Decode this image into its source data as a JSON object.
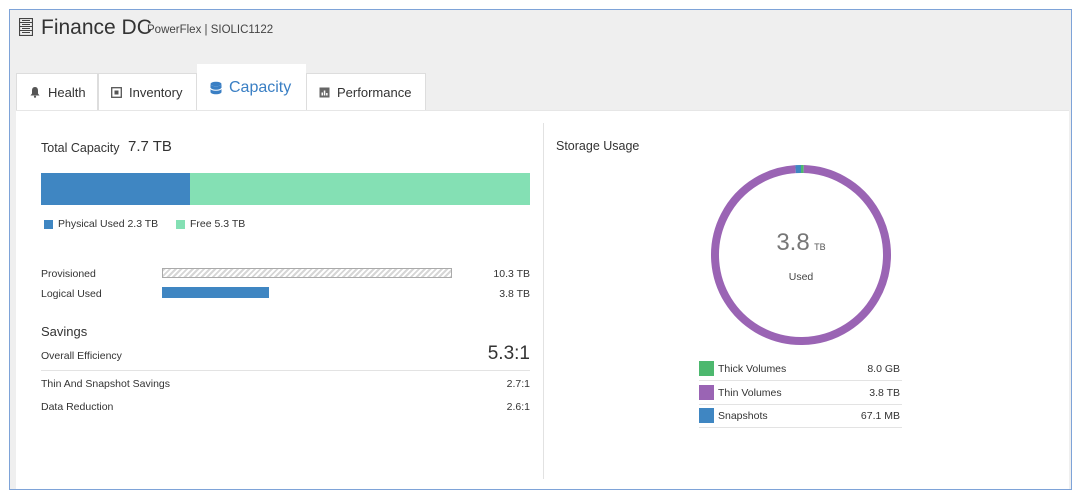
{
  "header": {
    "title": "Finance DC",
    "subtitle": "PowerFlex | SIOLIC1122"
  },
  "tabs": [
    {
      "label": "Health",
      "icon": "bell-icon"
    },
    {
      "label": "Inventory",
      "icon": "inventory-icon"
    },
    {
      "label": "Capacity",
      "icon": "database-icon",
      "active": true
    },
    {
      "label": "Performance",
      "icon": "performance-icon"
    }
  ],
  "capacity": {
    "total_label": "Total Capacity",
    "total_value": "7.7 TB",
    "used_fraction": 0.304,
    "colors": {
      "used": "#3f86c2",
      "free": "#84e0b4"
    },
    "legend": [
      {
        "label": "Physical Used 2.3 TB",
        "color": "#3f86c2"
      },
      {
        "label": "Free 5.3 TB",
        "color": "#84e0b4"
      }
    ],
    "provisioned": {
      "label": "Provisioned",
      "value": "10.3 TB"
    },
    "logical_used": {
      "label": "Logical Used",
      "value": "3.8 TB",
      "fraction": 0.37
    }
  },
  "savings": {
    "heading": "Savings",
    "overall": {
      "label": "Overall Efficiency",
      "value": "5.3:1"
    },
    "thin": {
      "label": "Thin And Snapshot Savings",
      "value": "2.7:1"
    },
    "reduction": {
      "label": "Data Reduction",
      "value": "2.6:1"
    }
  },
  "storage_usage": {
    "title": "Storage Usage",
    "center_value": "3.8",
    "center_unit": "TB",
    "center_label": "Used",
    "items": [
      {
        "label": "Thick Volumes",
        "value": "8.0 GB",
        "color": "#4db86e",
        "fraction": 0.005
      },
      {
        "label": "Thin Volumes",
        "value": "3.8 TB",
        "color": "#9a64b4",
        "fraction": 0.985
      },
      {
        "label": "Snapshots",
        "value": "67.1 MB",
        "color": "#3f86c2",
        "fraction": 0.01
      }
    ]
  }
}
